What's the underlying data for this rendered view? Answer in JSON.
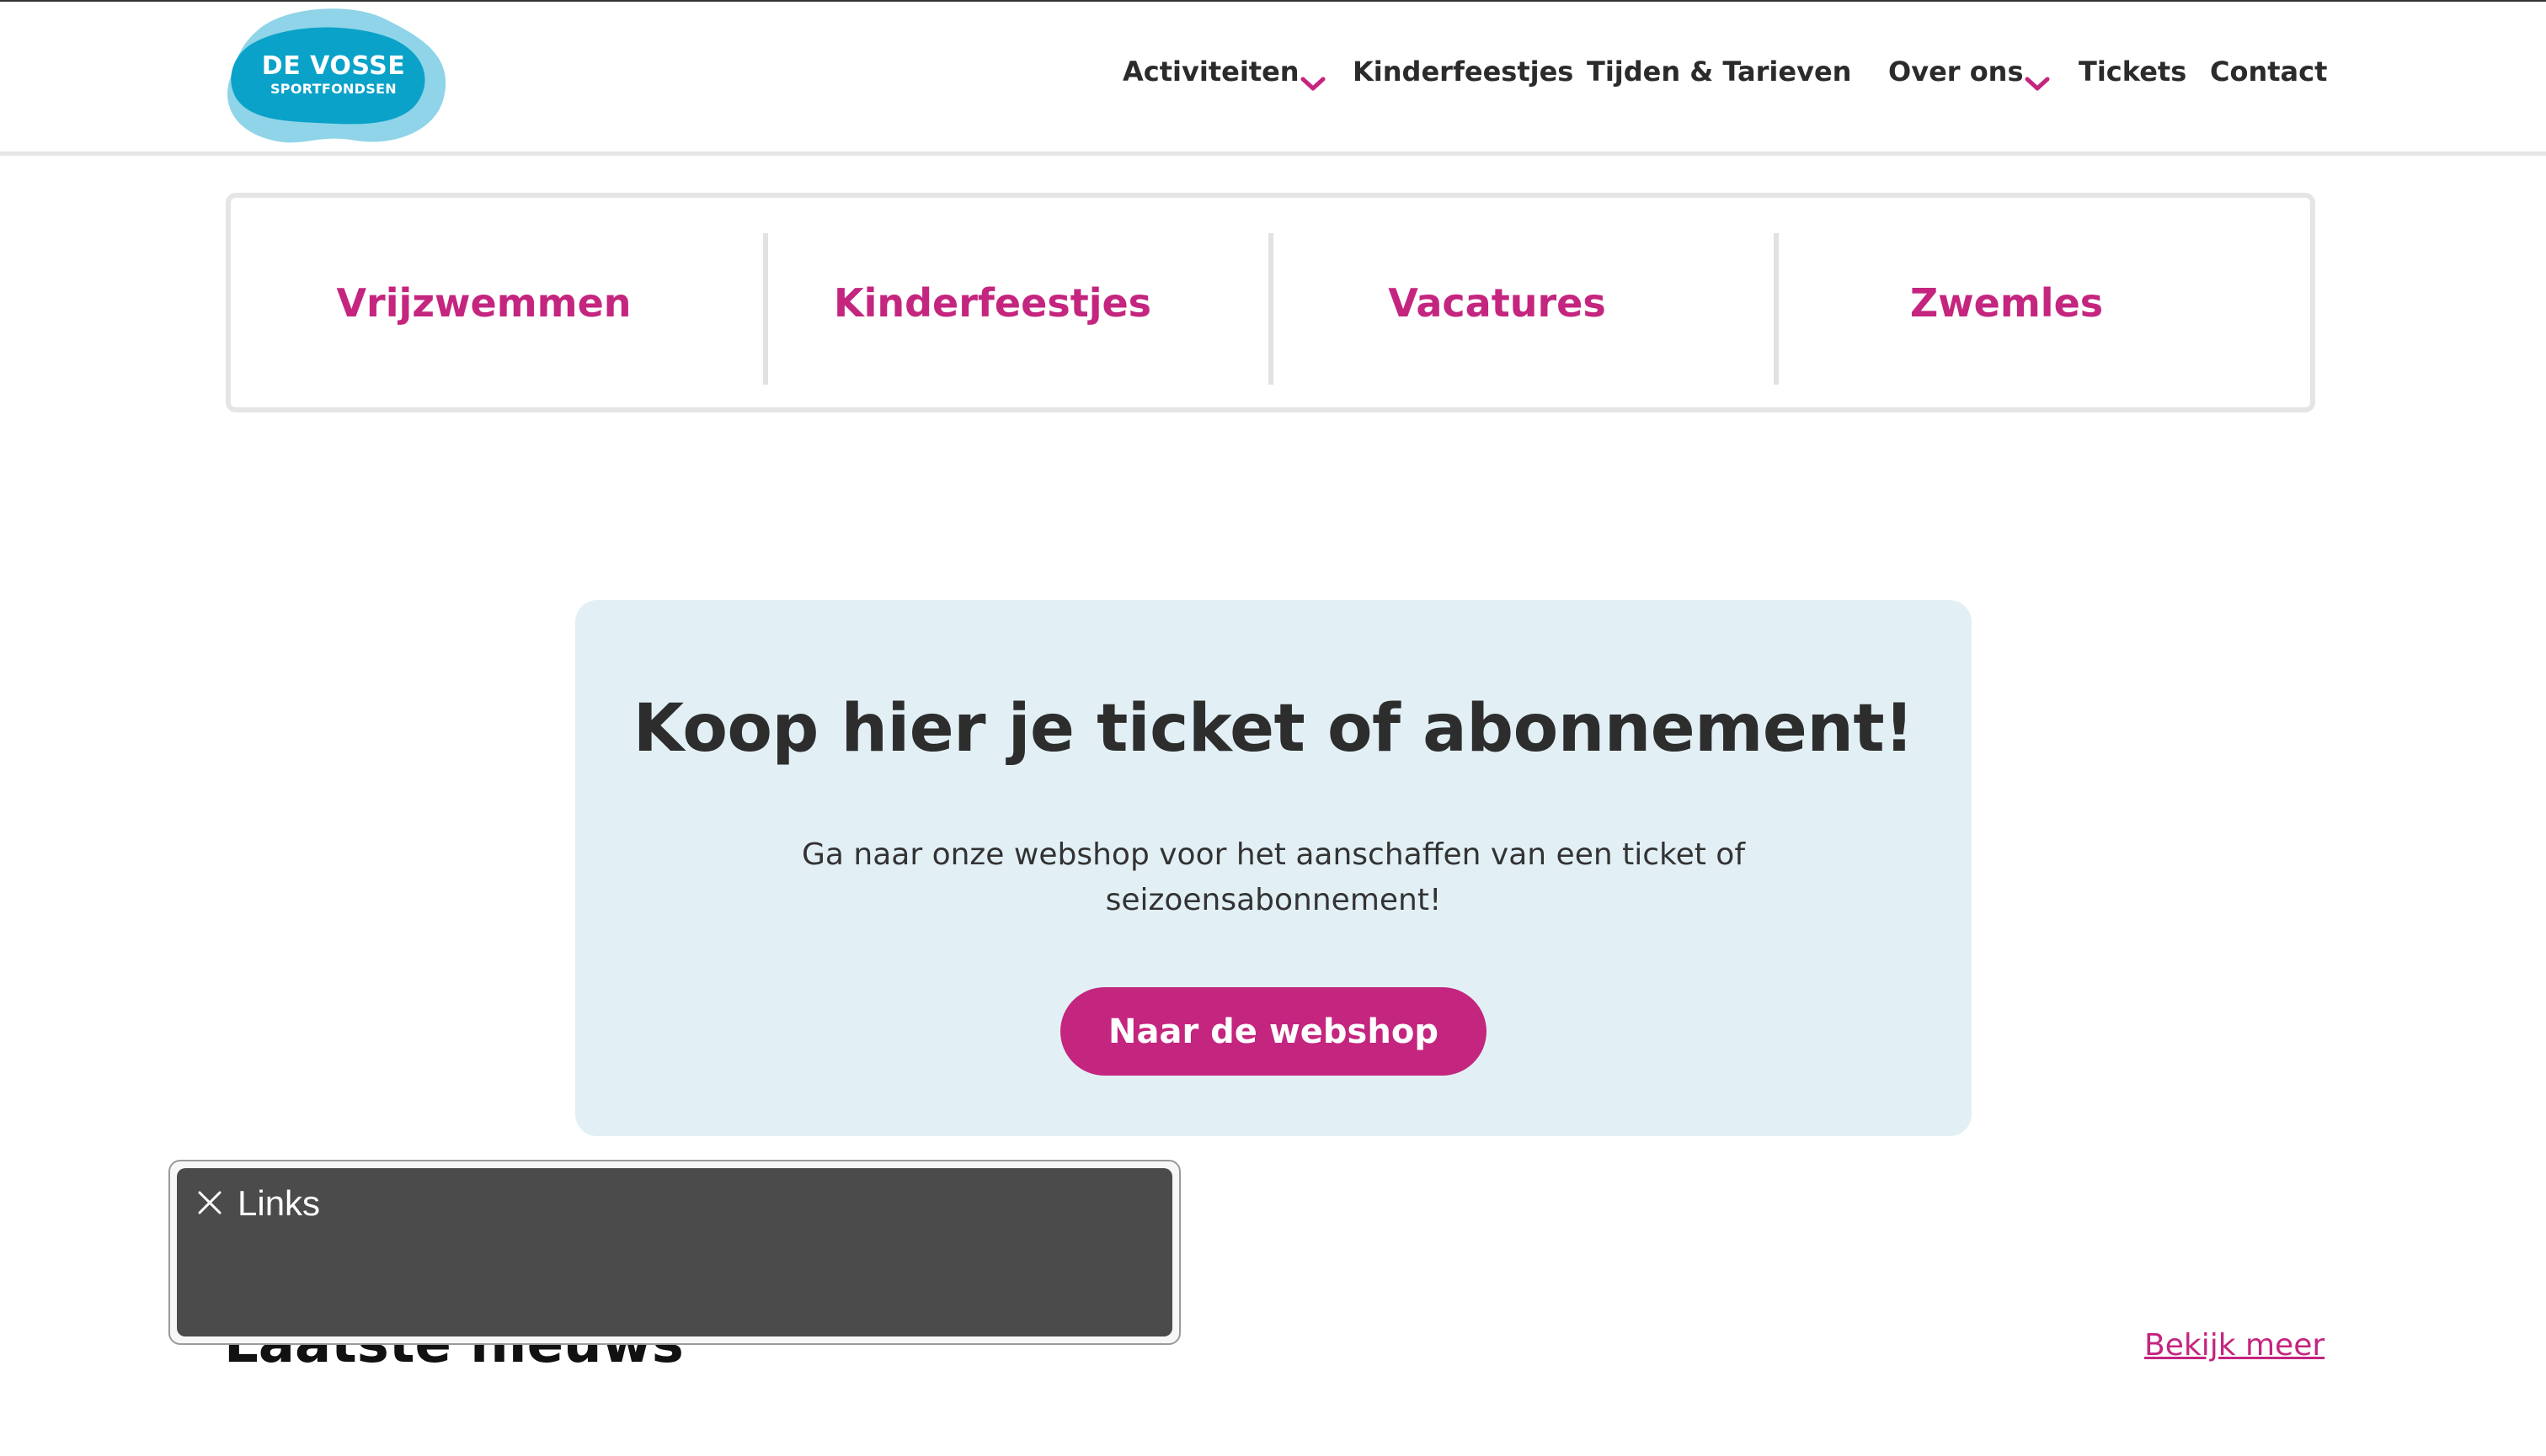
{
  "colors": {
    "accent": "#c4257f",
    "logo_blue": "#0aa2c8",
    "logo_light": "#8fd4e8",
    "promo_bg": "#e2f0f6",
    "overlay_bg": "#4b4b4b"
  },
  "logo": {
    "line1": "DE VOSSE",
    "line2": "SPORTFONDSEN"
  },
  "nav": {
    "items": [
      {
        "label": "Activiteiten",
        "has_dropdown": true
      },
      {
        "label": "Kinderfeestjes",
        "has_dropdown": false
      },
      {
        "label": "Tijden & Tarieven",
        "has_dropdown": false
      },
      {
        "label": "Over ons",
        "has_dropdown": true
      },
      {
        "label": "Tickets",
        "has_dropdown": false
      },
      {
        "label": "Contact",
        "has_dropdown": false
      }
    ]
  },
  "quick_links": [
    {
      "label": "Vrijzwemmen"
    },
    {
      "label": "Kinderfeestjes"
    },
    {
      "label": "Vacatures"
    },
    {
      "label": "Zwemles"
    }
  ],
  "promo": {
    "title": "Koop hier je ticket of abonnement!",
    "body": "Ga naar onze webshop voor het aanschaffen van een ticket of seizoensabonnement!",
    "button_label": "Naar de webshop"
  },
  "news": {
    "title": "Laatste nieuws",
    "more_label": "Bekijk meer"
  },
  "links_panel": {
    "label": "Links",
    "close_icon": "close-icon"
  }
}
